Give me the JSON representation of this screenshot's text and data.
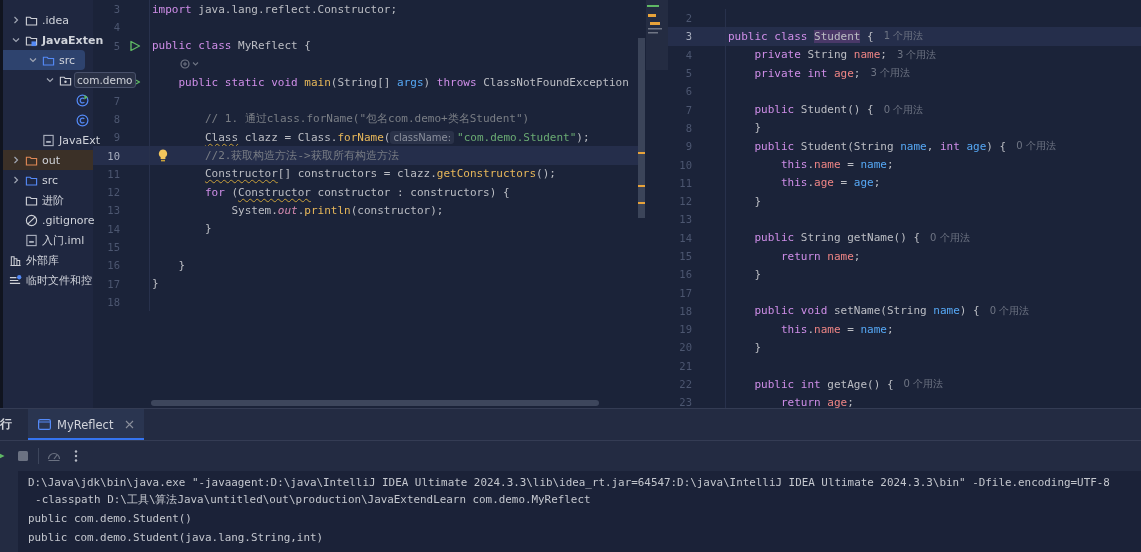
{
  "project_tree": {
    "items": [
      {
        "label": ".idea",
        "kind": "folder",
        "expanded": false,
        "selected": false
      },
      {
        "label": "JavaExten",
        "kind": "module",
        "expanded": true,
        "selected": false,
        "children": [
          {
            "label": "src",
            "kind": "source-folder",
            "expanded": true,
            "selected": true,
            "children": [
              {
                "label": "com.demo",
                "kind": "package",
                "expanded": true,
                "selected": false,
                "hovered": true,
                "children": [
                  {
                    "kind": "class-runnable",
                    "selected": false
                  },
                  {
                    "kind": "class",
                    "selected": false
                  }
                ]
              }
            ]
          },
          {
            "label": "JavaExt",
            "kind": "module-file",
            "selected": false
          }
        ]
      },
      {
        "label": "out",
        "kind": "excluded-folder",
        "expanded": false,
        "selected": false
      },
      {
        "label": "src",
        "kind": "source-folder",
        "expanded": false,
        "selected": false
      },
      {
        "label": "进阶",
        "kind": "folder",
        "selected": false
      },
      {
        "label": ".gitignore",
        "kind": "ignore-file",
        "selected": false
      },
      {
        "label": "入门.iml",
        "kind": "module-file",
        "selected": false
      },
      {
        "label": "外部库",
        "kind": "libraries",
        "selected": false
      },
      {
        "label": "临时文件和控",
        "kind": "scratches",
        "selected": false
      }
    ]
  },
  "editors": [
    {
      "lines": [
        {
          "kind": "code",
          "number": "3",
          "current": false,
          "tokens": [
            {
              "text": "import",
              "kind": "keyword"
            },
            {
              "text": " java.lang.reflect.Constructor;",
              "kind": "plain"
            }
          ]
        },
        {
          "kind": "code",
          "number": "4",
          "current": false
        },
        {
          "kind": "code",
          "number": "5",
          "current": false,
          "run": true,
          "tokens": [
            {
              "text": "public class",
              "kind": "keyword"
            },
            {
              "text": " MyReflect {",
              "kind": "plain"
            }
          ]
        },
        {
          "kind": "inlay"
        },
        {
          "kind": "code",
          "current": false,
          "run": true,
          "tokens": [
            {
              "text": "    public static void",
              "kind": "keyword"
            },
            {
              "text": " main",
              "kind": "method"
            },
            {
              "text": "(String[] ",
              "kind": "plain"
            },
            {
              "text": "args",
              "kind": "param"
            },
            {
              "text": ") ",
              "kind": "plain"
            },
            {
              "text": "throws",
              "kind": "keyword"
            },
            {
              "text": " ClassNotFoundException",
              "kind": "plain"
            }
          ]
        },
        {
          "kind": "code",
          "number": "7",
          "current": false
        },
        {
          "kind": "code",
          "number": "8",
          "current": false,
          "tokens": [
            {
              "text": "        // 1. 通过class.forName(\"包名com.demo+类名Student\")",
              "kind": "comment"
            }
          ]
        },
        {
          "kind": "code",
          "number": "9",
          "current": false,
          "tokens": [
            {
              "text": "        Class",
              "kind": "type-warn"
            },
            {
              "text": " clazz = Class.",
              "kind": "plain"
            },
            {
              "text": "forName",
              "kind": "method"
            },
            {
              "text": "(",
              "kind": "plain"
            },
            {
              "text": "className:",
              "kind": "hint"
            },
            {
              "text": "\"com.demo.Student\"",
              "kind": "string"
            },
            {
              "text": ");",
              "kind": "plain"
            }
          ]
        },
        {
          "kind": "code",
          "number": "10",
          "current": true,
          "bulb": true,
          "tokens": [
            {
              "text": "        //2.获取构造方法->获取所有构造方法",
              "kind": "comment"
            }
          ]
        },
        {
          "kind": "code",
          "number": "11",
          "current": false,
          "tokens": [
            {
              "text": "        Constructor",
              "kind": "type-warn"
            },
            {
              "text": "[] constructors = clazz.",
              "kind": "plain"
            },
            {
              "text": "getConstructors",
              "kind": "method"
            },
            {
              "text": "();",
              "kind": "plain"
            }
          ]
        },
        {
          "kind": "code",
          "number": "12",
          "current": false,
          "tokens": [
            {
              "text": "        for",
              "kind": "keyword"
            },
            {
              "text": " (",
              "kind": "plain"
            },
            {
              "text": "Constructor",
              "kind": "type-warn"
            },
            {
              "text": " constructor : constructors) {",
              "kind": "plain"
            }
          ]
        },
        {
          "kind": "code",
          "number": "13",
          "current": false,
          "tokens": [
            {
              "text": "            System.",
              "kind": "plain"
            },
            {
              "text": "out",
              "kind": "static"
            },
            {
              "text": ".",
              "kind": "plain"
            },
            {
              "text": "println",
              "kind": "method"
            },
            {
              "text": "(constructor);",
              "kind": "plain"
            }
          ]
        },
        {
          "kind": "code",
          "number": "14",
          "current": false,
          "tokens": [
            {
              "text": "        }",
              "kind": "plain"
            }
          ]
        },
        {
          "kind": "code",
          "number": "15",
          "current": false
        },
        {
          "kind": "code",
          "number": "16",
          "current": false,
          "tokens": [
            {
              "text": "    }",
              "kind": "plain"
            }
          ]
        },
        {
          "kind": "code",
          "number": "17",
          "current": false,
          "tokens": [
            {
              "text": "}",
              "kind": "plain"
            }
          ]
        },
        {
          "kind": "code",
          "number": "18",
          "current": false
        }
      ]
    },
    {
      "lines": [
        {
          "kind": "code",
          "number": "2",
          "current": false
        },
        {
          "kind": "code",
          "number": "3",
          "current": true,
          "usage": "1 个用法",
          "tokens": [
            {
              "text": "public class ",
              "kind": "keyword"
            },
            {
              "text": "Student",
              "kind": "highlight"
            },
            {
              "text": " {",
              "kind": "plain"
            }
          ]
        },
        {
          "kind": "code",
          "number": "4",
          "current": false,
          "usage": "3 个用法",
          "tokens": [
            {
              "text": "    private",
              "kind": "keyword"
            },
            {
              "text": " String ",
              "kind": "plain"
            },
            {
              "text": "name",
              "kind": "field"
            },
            {
              "text": ";",
              "kind": "plain"
            }
          ]
        },
        {
          "kind": "code",
          "number": "5",
          "current": false,
          "usage": "3 个用法",
          "tokens": [
            {
              "text": "    private int ",
              "kind": "keyword"
            },
            {
              "text": "age",
              "kind": "field"
            },
            {
              "text": ";",
              "kind": "plain"
            }
          ]
        },
        {
          "kind": "code",
          "number": "6",
          "current": false
        },
        {
          "kind": "code",
          "number": "7",
          "current": false,
          "usage": "0 个用法",
          "tokens": [
            {
              "text": "    public",
              "kind": "keyword"
            },
            {
              "text": " Student() {",
              "kind": "plain"
            }
          ]
        },
        {
          "kind": "code",
          "number": "8",
          "current": false,
          "tokens": [
            {
              "text": "    }",
              "kind": "plain"
            }
          ]
        },
        {
          "kind": "code",
          "number": "9",
          "current": false,
          "usage": "0 个用法",
          "tokens": [
            {
              "text": "    public",
              "kind": "keyword"
            },
            {
              "text": " Student(String ",
              "kind": "plain"
            },
            {
              "text": "name",
              "kind": "param"
            },
            {
              "text": ", ",
              "kind": "plain"
            },
            {
              "text": "int",
              "kind": "keyword"
            },
            {
              "text": " age",
              "kind": "param"
            },
            {
              "text": ") {",
              "kind": "plain"
            }
          ]
        },
        {
          "kind": "code",
          "number": "10",
          "current": false,
          "tokens": [
            {
              "text": "        this",
              "kind": "keyword"
            },
            {
              "text": ".",
              "kind": "plain"
            },
            {
              "text": "name",
              "kind": "field"
            },
            {
              "text": " = ",
              "kind": "plain"
            },
            {
              "text": "name",
              "kind": "param"
            },
            {
              "text": ";",
              "kind": "plain"
            }
          ]
        },
        {
          "kind": "code",
          "number": "11",
          "current": false,
          "tokens": [
            {
              "text": "        this",
              "kind": "keyword"
            },
            {
              "text": ".",
              "kind": "plain"
            },
            {
              "text": "age",
              "kind": "field"
            },
            {
              "text": " = ",
              "kind": "plain"
            },
            {
              "text": "age",
              "kind": "param"
            },
            {
              "text": ";",
              "kind": "plain"
            }
          ]
        },
        {
          "kind": "code",
          "number": "12",
          "current": false,
          "tokens": [
            {
              "text": "    }",
              "kind": "plain"
            }
          ]
        },
        {
          "kind": "code",
          "number": "13",
          "current": false
        },
        {
          "kind": "code",
          "number": "14",
          "current": false,
          "usage": "0 个用法",
          "tokens": [
            {
              "text": "    public",
              "kind": "keyword"
            },
            {
              "text": " String getName() {",
              "kind": "plain"
            }
          ]
        },
        {
          "kind": "code",
          "number": "15",
          "current": false,
          "tokens": [
            {
              "text": "        return",
              "kind": "keyword"
            },
            {
              "text": " name",
              "kind": "field"
            },
            {
              "text": ";",
              "kind": "plain"
            }
          ]
        },
        {
          "kind": "code",
          "number": "16",
          "current": false,
          "tokens": [
            {
              "text": "    }",
              "kind": "plain"
            }
          ]
        },
        {
          "kind": "code",
          "number": "17",
          "current": false
        },
        {
          "kind": "code",
          "number": "18",
          "current": false,
          "usage": "0 个用法",
          "tokens": [
            {
              "text": "    public void",
              "kind": "keyword"
            },
            {
              "text": " setName(String ",
              "kind": "plain"
            },
            {
              "text": "name",
              "kind": "param"
            },
            {
              "text": ") {",
              "kind": "plain"
            }
          ]
        },
        {
          "kind": "code",
          "number": "19",
          "current": false,
          "tokens": [
            {
              "text": "        this",
              "kind": "keyword"
            },
            {
              "text": ".",
              "kind": "plain"
            },
            {
              "text": "name",
              "kind": "field"
            },
            {
              "text": " = ",
              "kind": "plain"
            },
            {
              "text": "name",
              "kind": "param"
            },
            {
              "text": ";",
              "kind": "plain"
            }
          ]
        },
        {
          "kind": "code",
          "number": "20",
          "current": false,
          "tokens": [
            {
              "text": "    }",
              "kind": "plain"
            }
          ]
        },
        {
          "kind": "code",
          "number": "21",
          "current": false
        },
        {
          "kind": "code",
          "number": "22",
          "current": false,
          "usage": "0 个用法",
          "tokens": [
            {
              "text": "    public int",
              "kind": "keyword"
            },
            {
              "text": " getAge() {",
              "kind": "plain"
            }
          ]
        },
        {
          "kind": "code",
          "number": "23",
          "current": false,
          "tokens": [
            {
              "text": "        return",
              "kind": "keyword"
            },
            {
              "text": " age",
              "kind": "field"
            },
            {
              "text": ";",
              "kind": "plain"
            }
          ]
        }
      ]
    }
  ],
  "run_panel": {
    "title": "行",
    "tabs": [
      {
        "label": "MyReflect",
        "selected": true
      }
    ],
    "console": {
      "lines": [
        "D:\\Java\\jdk\\bin\\java.exe \"-javaagent:D:\\java\\IntelliJ IDEA Ultimate 2024.3.3\\lib\\idea_rt.jar=64547:D:\\java\\IntelliJ IDEA Ultimate 2024.3.3\\bin\" -Dfile.encoding=UTF-8",
        " -classpath D:\\工具\\算法Java\\untitled\\out\\production\\JavaExtendLearn com.demo.MyReflect",
        "public com.demo.Student()",
        "public com.demo.Student(java.lang.String,int)"
      ]
    }
  }
}
